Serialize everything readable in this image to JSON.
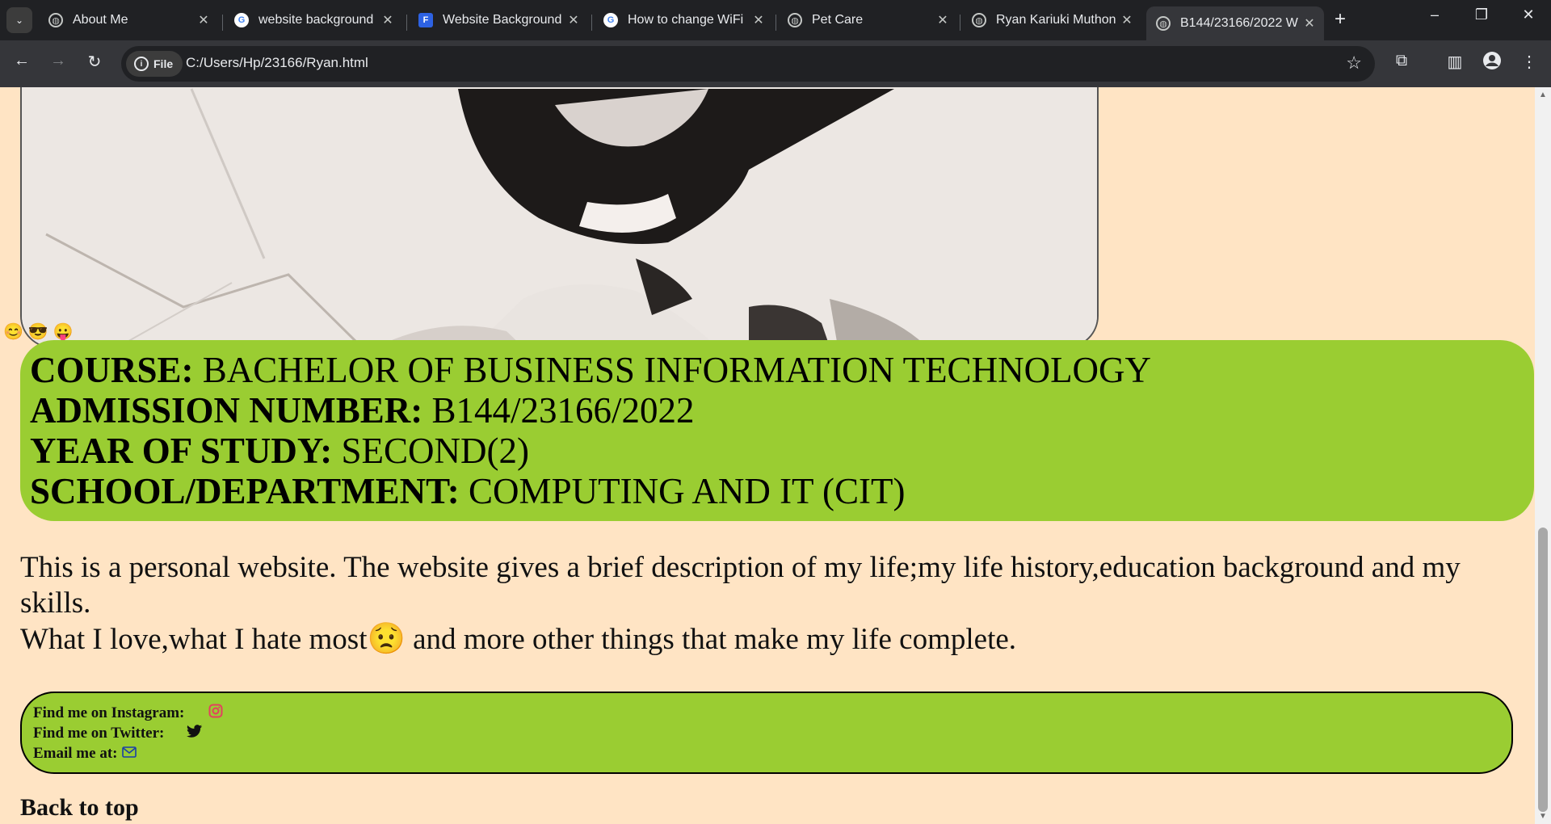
{
  "browser": {
    "tab_menu_icon": "chevron-down-icon",
    "tabs": [
      {
        "title": "About Me",
        "icon": "globe-icon"
      },
      {
        "title": "website background",
        "icon": "google-icon"
      },
      {
        "title": "Website Background",
        "icon": "forms-icon"
      },
      {
        "title": "How to change WiFi",
        "icon": "google-icon"
      },
      {
        "title": "Pet Care",
        "icon": "globe-icon"
      },
      {
        "title": "Ryan Kariuki Muthon",
        "icon": "globe-icon"
      },
      {
        "title": "B144/23166/2022 W",
        "icon": "globe-icon",
        "active": true
      }
    ],
    "new_tab_label": "+",
    "window_controls": {
      "minimize": "–",
      "restore": "❐",
      "close": "✕"
    },
    "toolbar": {
      "back": "←",
      "forward": "→",
      "reload": "↻",
      "file_chip": "File",
      "url": "C:/Users/Hp/23166/Ryan.html"
    }
  },
  "page": {
    "emojis": [
      "😊",
      "😎",
      "😛"
    ],
    "details": [
      {
        "label": "COURSE:",
        "value": " BACHELOR OF BUSINESS INFORMATION TECHNOLOGY"
      },
      {
        "label": "ADMISSION NUMBER:",
        "value": " B144/23166/2022"
      },
      {
        "label": "YEAR OF STUDY:",
        "value": " SECOND(2)"
      },
      {
        "label": "SCHOOL/DEPARTMENT:",
        "value": " COMPUTING AND IT (CIT)"
      }
    ],
    "description": {
      "line1": "This is a personal website. The website gives a brief description of my life;my life history,education background and my skills.",
      "line2_start": "What I love,what I hate most",
      "line2_emoji": "😟",
      "line2_end": " and more other things that make my life complete."
    },
    "social": {
      "instagram_label": "Find me on Instagram:",
      "twitter_label": "Find me on Twitter:",
      "email_label": "Email me at:"
    },
    "back_to_top": "Back to top"
  },
  "colors": {
    "page_bg": "#ffe4c4",
    "box_green": "#9acd32",
    "instagram": "#e4405f"
  }
}
